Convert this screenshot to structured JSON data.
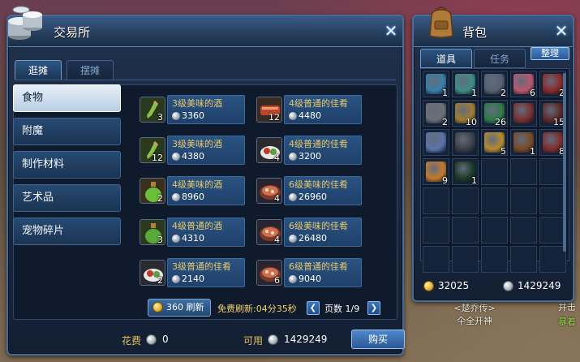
{
  "trade": {
    "title": "交易所",
    "tabs": [
      "逛摊",
      "摆摊"
    ],
    "categories": [
      "食物",
      "附魔",
      "制作材料",
      "艺术品",
      "宠物碎片"
    ],
    "items": [
      {
        "name": "3级美味的酒",
        "price": "3360",
        "qty": "3",
        "icon": "wine-bottle-icon"
      },
      {
        "name": "4级普通的佳肴",
        "price": "4480",
        "qty": "12",
        "icon": "meat-skewer-icon"
      },
      {
        "name": "3级美味的酒",
        "price": "4380",
        "qty": "12",
        "icon": "wine-bottle-icon"
      },
      {
        "name": "4级普通的佳肴",
        "price": "3200",
        "qty": "4",
        "icon": "food-plate-icon"
      },
      {
        "name": "4级美味的酒",
        "price": "8960",
        "qty": "2",
        "icon": "potion-jar-icon"
      },
      {
        "name": "6级美味的佳肴",
        "price": "26960",
        "qty": "4",
        "icon": "stew-pot-icon"
      },
      {
        "name": "4级普通的酒",
        "price": "4310",
        "qty": "3",
        "icon": "potion-jar-icon"
      },
      {
        "name": "6级美味的佳肴",
        "price": "26480",
        "qty": "4",
        "icon": "stew-pot-icon"
      },
      {
        "name": "3级普通的佳肴",
        "price": "2140",
        "qty": "2",
        "icon": "food-plate-icon"
      },
      {
        "name": "6级普通的佳肴",
        "price": "9040",
        "qty": "6",
        "icon": "stew-pot-icon"
      }
    ],
    "refresh_label": "360 刷新",
    "free_refresh": "免费刷新:04分35秒",
    "page_label": "页数 1/9",
    "fee_label": "花费",
    "fee_value": "0",
    "available_label": "可用",
    "available_value": "1429249",
    "buy_label": "购买"
  },
  "bag": {
    "title": "背包",
    "tabs": [
      "道具",
      "任务"
    ],
    "sort_label": "整理",
    "gold": "32025",
    "silver": "1429249",
    "slots": [
      {
        "qty": "1",
        "color": "#3a7ea8"
      },
      {
        "qty": "1",
        "color": "#3f8c86"
      },
      {
        "qty": "2",
        "color": "#556070"
      },
      {
        "qty": "6",
        "color": "#b9566e"
      },
      {
        "qty": "2",
        "color": "#8a2a2a"
      },
      {
        "qty": "2",
        "color": "#6c6f76"
      },
      {
        "qty": "10",
        "color": "#a07c30"
      },
      {
        "qty": "26",
        "color": "#2f7a4a"
      },
      {
        "qty": "",
        "color": "#7a3030"
      },
      {
        "qty": "15",
        "color": "#5a2a2a"
      },
      {
        "qty": "",
        "color": "#5a74a6"
      },
      {
        "qty": "",
        "color": "#3c3f46"
      },
      {
        "qty": "5",
        "color": "#b48a2e"
      },
      {
        "qty": "1",
        "color": "#7a4a26"
      },
      {
        "qty": "8",
        "color": "#7e2e2e"
      },
      {
        "qty": "9",
        "color": "#c47a2a"
      },
      {
        "qty": "1",
        "color": "#1e3a26"
      }
    ]
  },
  "background": {
    "npc_title": "<楚乔传>",
    "npc_name": "仐全开神",
    "side_text_1": "并击",
    "side_text_2": "暴着"
  }
}
